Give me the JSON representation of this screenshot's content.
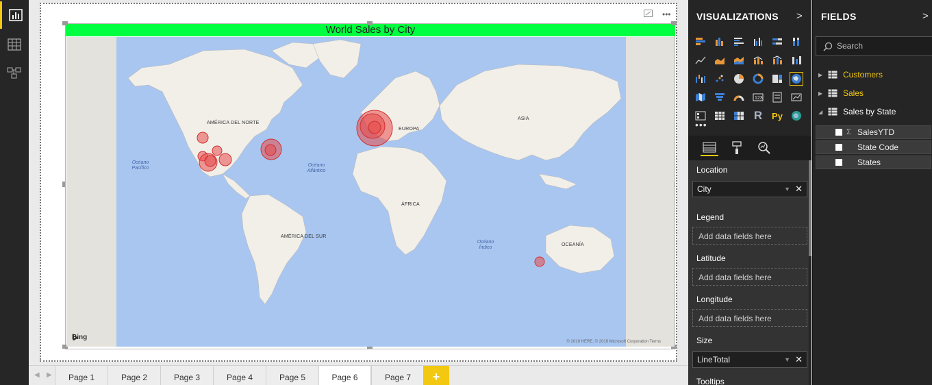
{
  "report": {
    "visual_title": "World Sales by City",
    "map": {
      "labels": {
        "north_america": "AMÉRICA DEL NORTE",
        "south_america": "AMÉRICA DEL SUR",
        "europe": "EUROPA",
        "africa": "ÁFRICA",
        "asia": "ASIA",
        "oceania": "OCEANÍA",
        "pacific": "Océano Pacífico",
        "atlantic": "Océano Atlántico",
        "indian": "Océano Índico"
      },
      "bing": "Bing",
      "credit": "© 2019 HERE, © 2019 Microsoft Corporation  Terms"
    }
  },
  "page_tabs": [
    "Page 1",
    "Page 2",
    "Page 3",
    "Page 4",
    "Page 5",
    "Page 6",
    "Page 7"
  ],
  "active_tab": "Page 6",
  "add_tab": "+",
  "visualizations": {
    "title": "VISUALIZATIONS",
    "more": "•••",
    "wells": {
      "location_label": "Location",
      "location_value": "City",
      "legend_label": "Legend",
      "latitude_label": "Latitude",
      "longitude_label": "Longitude",
      "size_label": "Size",
      "size_value": "LineTotal",
      "tooltips_label": "Tooltips",
      "placeholder": "Add data fields here"
    },
    "r_label": "R",
    "py_label": "Py"
  },
  "fields": {
    "title": "FIELDS",
    "search_placeholder": "Search",
    "tables": [
      {
        "name": "Customers",
        "highlight": true
      },
      {
        "name": "Sales",
        "highlight": true
      },
      {
        "name": "Sales by State",
        "highlight": false
      }
    ],
    "sales_by_state_fields": [
      {
        "name": "SalesYTD",
        "sigma": "Σ"
      },
      {
        "name": "State Code",
        "sigma": ""
      },
      {
        "name": "States",
        "sigma": ""
      }
    ]
  },
  "colors": {
    "accent": "#f2c811",
    "title_bar": "#00ff40",
    "bubble": "#e84a4a",
    "ocean": "#a8c6f0",
    "land": "#f2efe9"
  }
}
